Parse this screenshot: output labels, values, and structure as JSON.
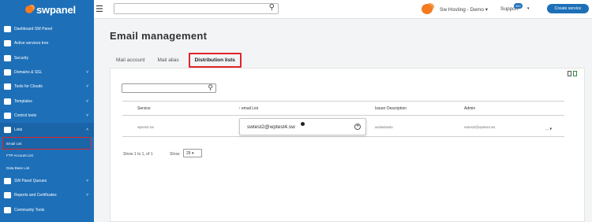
{
  "app": {
    "logo_text": "swpanel"
  },
  "topbar": {
    "search_value": "",
    "account_label": "Sw Hosting - Demo",
    "support_label": "Support",
    "support_badge": "360",
    "create_service_label": "Create service",
    "brand_color": "#1d6fb8",
    "accent_color": "#f47b20"
  },
  "sidebar": {
    "items": [
      {
        "label": "Dashboard SW Panel",
        "icon": "dashboard-icon",
        "chevron": false
      },
      {
        "label": "Active services tree",
        "icon": "tree-icon",
        "chevron": false
      },
      {
        "label": "Security",
        "icon": "shield-icon",
        "chevron": false
      },
      {
        "label": "Domains & SSL",
        "icon": "globe-icon",
        "chevron": true
      },
      {
        "label": "Tools for Clouds",
        "icon": "toolbox-icon",
        "chevron": true
      },
      {
        "label": "Templates",
        "icon": "file-icon",
        "chevron": true
      },
      {
        "label": "Control tools",
        "icon": "check-icon",
        "chevron": true
      },
      {
        "label": "Lists",
        "icon": "list-icon",
        "chevron": true,
        "open": true
      }
    ],
    "sub_items": [
      {
        "label": "Email List",
        "active": true
      },
      {
        "label": "FTP Account List",
        "active": false
      },
      {
        "label": "Data Base List",
        "active": false
      }
    ],
    "bottom_items": [
      {
        "label": "SW Panel Queues",
        "icon": "layers-icon",
        "chevron": true
      },
      {
        "label": "Reports and Certificates",
        "icon": "report-icon",
        "chevron": true
      },
      {
        "label": "Community Tools",
        "icon": "community-icon",
        "chevron": false
      }
    ]
  },
  "main": {
    "title": "Email management",
    "tabs": [
      "Mail account",
      "Mail alias",
      "Distribution lists"
    ],
    "active_tab": "Distribution lists",
    "search_value": "",
    "table": {
      "columns": [
        "Service",
        "↑ email List",
        "Issuer Description",
        "Admin"
      ],
      "rows": [
        {
          "service": "wptest4.sw",
          "email_list": "swtest2@wptest4.sw",
          "description": "asdasdasda",
          "admin": "swtest2@wptest4.sw",
          "actions": "..."
        }
      ]
    },
    "footer": {
      "show_text": "Show 1 to 1, of 1",
      "show_label": "Show",
      "page_size": "25"
    }
  }
}
